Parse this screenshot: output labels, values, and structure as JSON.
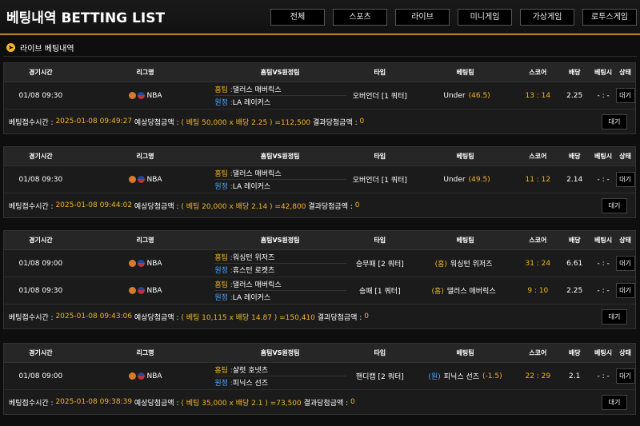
{
  "header": {
    "title": "베팅내역 BETTING LIST",
    "tabs": [
      "전체",
      "스포츠",
      "라이브",
      "미니게임",
      "가상게임",
      "로투스게임"
    ]
  },
  "section": {
    "icon": "arrow-right-icon",
    "title": "라이브 베팅내역"
  },
  "columns": [
    "경기시간",
    "리그명",
    "홈팀VS원정팀",
    "타입",
    "베팅팀",
    "스코어",
    "배당",
    "베팅시",
    "상태"
  ],
  "labels": {
    "home": "홈팀 :",
    "away": "원정 :",
    "receipt": "베팅접수시간 :",
    "expected": "예상당첨금액 :",
    "result": "결과당첨금액 :",
    "status": "대기",
    "dash": "- : -"
  },
  "cards": [
    {
      "rows": [
        {
          "time": "01/08 09:30",
          "league": "NBA",
          "home": "댈러스 매버릭스",
          "away": "LA 레이커스",
          "type": "오버언더 [1 쿼터]",
          "pick_prefix": "",
          "pick": "Under",
          "pick_val": "(46.5)",
          "score": "13 : 14",
          "odds": "2.25"
        }
      ],
      "receipt_time": "2025-01-08 09:49:27",
      "calc": "( 베팅 50,000 x 배당 2.25 ) =112,500",
      "result_amount": "0"
    },
    {
      "rows": [
        {
          "time": "01/08 09:30",
          "league": "NBA",
          "home": "댈러스 매버릭스",
          "away": "LA 레이커스",
          "type": "오버언더 [1 쿼터]",
          "pick_prefix": "",
          "pick": "Under",
          "pick_val": "(49.5)",
          "score": "11 : 12",
          "odds": "2.14"
        }
      ],
      "receipt_time": "2025-01-08 09:44:02",
      "calc": "( 베팅 20,000 x 배당 2.14 ) =42,800",
      "result_amount": "0"
    },
    {
      "rows": [
        {
          "time": "01/08 09:00",
          "league": "NBA",
          "home": "워싱턴 위저즈",
          "away": "휴스턴 로켓츠",
          "type": "승무패 [2 쿼터]",
          "pick_prefix": "(홈)",
          "pick": "워싱턴 위저즈",
          "pick_val": "",
          "score": "31 : 24",
          "odds": "6.61"
        },
        {
          "time": "01/08 09:30",
          "league": "NBA",
          "home": "댈러스 매버릭스",
          "away": "LA 레이커스",
          "type": "승패 [1 쿼터]",
          "pick_prefix": "(홈)",
          "pick": "댈러스 매버릭스",
          "pick_val": "",
          "score": "9 : 10",
          "odds": "2.25"
        }
      ],
      "receipt_time": "2025-01-08 09:43:06",
      "calc": "( 베팅 10,115 x 배당 14.87 ) =150,410",
      "result_amount": "0"
    },
    {
      "rows": [
        {
          "time": "01/08 09:00",
          "league": "NBA",
          "home": "샬럿 호넷츠",
          "away": "피닉스 선즈",
          "type": "핸디캡 [2 쿼터]",
          "pick_prefix": "(원)",
          "pick": "피닉스 선즈",
          "pick_val": "(-1.5)",
          "score": "22 : 29",
          "odds": "2.1"
        }
      ],
      "receipt_time": "2025-01-08 09:38:39",
      "calc": "( 베팅 35,000 x 배당 2.1 ) =73,500",
      "result_amount": "0"
    }
  ]
}
